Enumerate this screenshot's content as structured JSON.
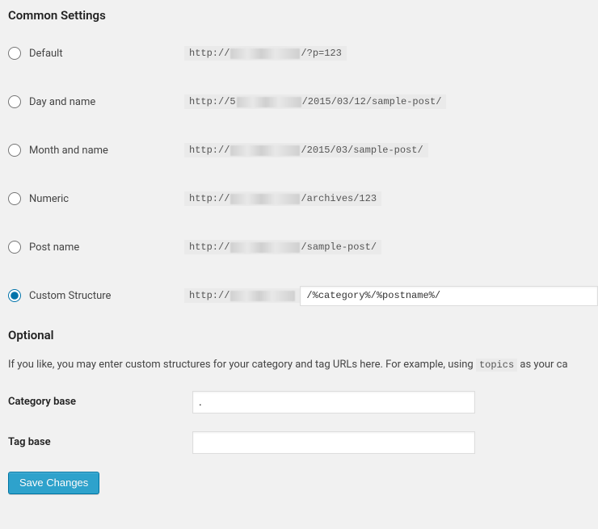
{
  "headings": {
    "common": "Common Settings",
    "optional": "Optional"
  },
  "permalink_options": [
    {
      "label": "Default",
      "prefix": "http://",
      "blur_w": 86,
      "suffix": "/?p=123",
      "checked": false,
      "name": "opt-default"
    },
    {
      "label": "Day and name",
      "prefix": "http://5",
      "blur_w": 80,
      "suffix": "/2015/03/12/sample-post/",
      "checked": false,
      "name": "opt-day-name"
    },
    {
      "label": "Month and name",
      "prefix": "http://",
      "blur_w": 86,
      "suffix": "/2015/03/sample-post/",
      "checked": false,
      "name": "opt-month-name"
    },
    {
      "label": "Numeric",
      "prefix": "http://",
      "blur_w": 86,
      "suffix": "/archives/123",
      "checked": false,
      "name": "opt-numeric"
    },
    {
      "label": "Post name",
      "prefix": "http://",
      "blur_w": 86,
      "suffix": "/sample-post/",
      "checked": false,
      "name": "opt-post-name"
    }
  ],
  "custom": {
    "label": "Custom Structure",
    "prefix": "http://",
    "blur_w": 80,
    "value": "/%category%/%postname%/",
    "checked": true,
    "name": "opt-custom"
  },
  "optional_text": {
    "pre": "If you like, you may enter custom structures for your category and tag URLs here. For example, using ",
    "code": "topics",
    "post": " as your ca"
  },
  "fields": {
    "category_base": {
      "label": "Category base",
      "value": "."
    },
    "tag_base": {
      "label": "Tag base",
      "value": ""
    }
  },
  "buttons": {
    "save": "Save Changes"
  }
}
